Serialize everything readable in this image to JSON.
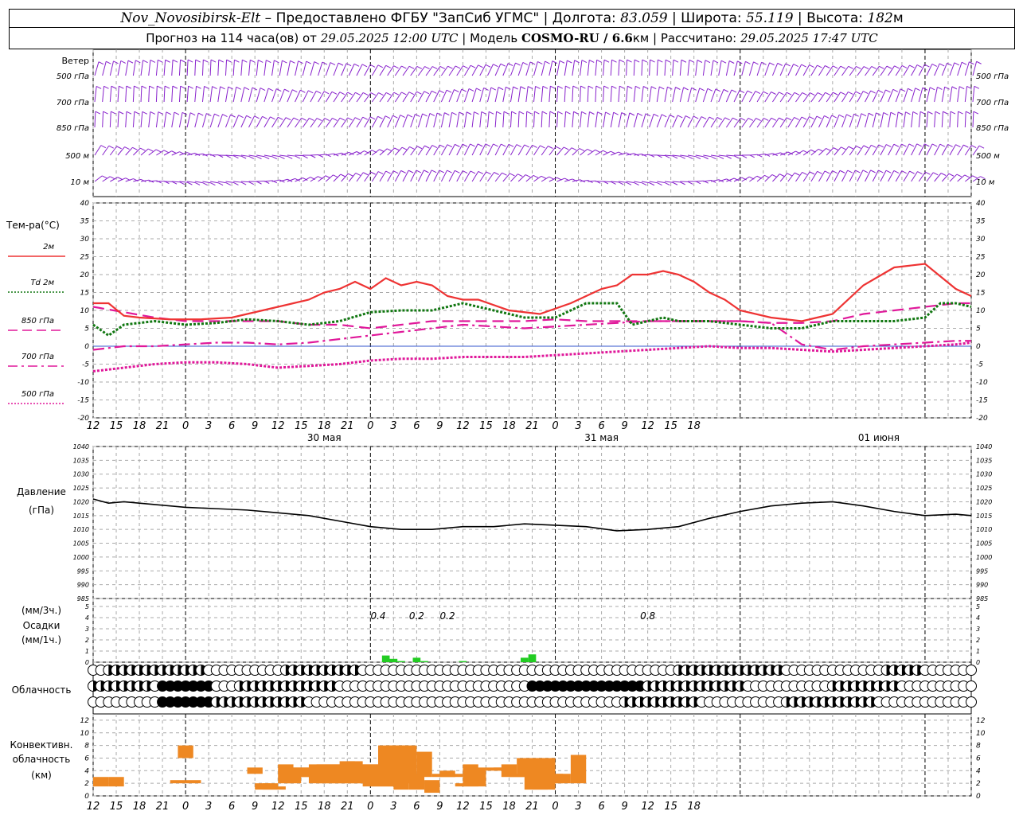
{
  "header": {
    "station": "Nov_Novosibirsk-Elt",
    "dash": " – ",
    "provider": "Предоставлено ФГБУ \"ЗапСиб УГМС\"",
    "lon_label": "Долгота:",
    "lon": "83.059",
    "lat_label": "Широта:",
    "lat": "55.119",
    "alt_label": "Высота:",
    "alt": "182",
    "alt_unit": "м",
    "sep": " | ",
    "forecast_label": "Прогноз на 114 часа(ов)",
    "from_label": "от",
    "forecast_start": "29.05.2025 12:00 UTC",
    "model_label": "Модель",
    "model": "COSMO-RU / 6.6",
    "model_unit": "км",
    "calc_label": "Рассчитано:",
    "calc_time": "29.05.2025 17:47 UTC"
  },
  "colors": {
    "t2m": "#ee3333",
    "td2m": "#117711",
    "t850": "#e0189a",
    "t700": "#e0189a",
    "t500": "#e0189a",
    "wind": "#8822cc",
    "precip": "#22cc22",
    "conv": "#ee8822",
    "pressure": "#000000",
    "grid": "#aaaaaa"
  },
  "wind": {
    "title": "Ветер",
    "levels": [
      "500 гПа",
      "700 гПа",
      "850 гПа",
      "500 м",
      "10  м"
    ]
  },
  "temperature": {
    "title": "Тем-ра(°C)",
    "legend": [
      {
        "label": "2м",
        "style": "solid"
      },
      {
        "label": "Td  2м",
        "style": "dotted"
      },
      {
        "label": "850 гПа",
        "style": "dashed"
      },
      {
        "label": "700 гПа",
        "style": "dashdot"
      },
      {
        "label": "500 гПа",
        "style": "dotted"
      }
    ],
    "y_ticks": [
      "40",
      "35",
      "30",
      "25",
      "20",
      "15",
      "10",
      "5",
      "0",
      "-5",
      "-10",
      "-15",
      "-20"
    ],
    "x_ticks": [
      "12",
      "15",
      "18",
      "21",
      "0",
      "3",
      "6",
      "9",
      "12",
      "15",
      "18",
      "21",
      "0",
      "3",
      "6",
      "9",
      "12",
      "15",
      "18",
      "21",
      "0",
      "3",
      "6",
      "9",
      "12",
      "15",
      "18"
    ],
    "dates": [
      "30 мая",
      "31 мая",
      "01 июня"
    ]
  },
  "pressure": {
    "title": "Давление",
    "unit": "(гПа)",
    "y_ticks": [
      "1040",
      "1035",
      "1030",
      "1025",
      "1020",
      "1015",
      "1010",
      "1005",
      "1000",
      "995",
      "990",
      "985"
    ]
  },
  "precip": {
    "unit3": "(мм/3ч.)",
    "title": "Осадки",
    "unit1": "(мм/1ч.)",
    "y_ticks": [
      "5",
      "4",
      "3",
      "2",
      "1",
      "0"
    ],
    "labels": [
      "0.4",
      "0.2",
      "0.2",
      "0.8"
    ]
  },
  "cloud": {
    "title": "Облачность"
  },
  "convective": {
    "title1": "Конвективн.",
    "title2": "облачность",
    "unit": "(км)",
    "y_ticks": [
      "12",
      "10",
      "8",
      "6",
      "4",
      "2",
      "0"
    ],
    "x_ticks": [
      "12",
      "15",
      "18",
      "21",
      "0",
      "3",
      "6",
      "9",
      "12",
      "15",
      "18",
      "21",
      "0",
      "3",
      "6",
      "9",
      "12",
      "15",
      "18",
      "21",
      "0",
      "3",
      "6",
      "9",
      "12",
      "15",
      "18"
    ]
  },
  "chart_data": [
    {
      "type": "line",
      "title": "Тем-ра(°C)",
      "x_unit": "hours from 29.05.2025 12:00 UTC",
      "ylim": [
        -20,
        40
      ],
      "series": [
        {
          "name": "2м",
          "x": [
            0,
            2,
            4,
            6,
            10,
            14,
            18,
            22,
            26,
            28,
            30,
            32,
            34,
            36,
            38,
            40,
            42,
            44,
            46,
            48,
            50,
            54,
            58,
            62,
            64,
            66,
            68,
            70,
            72,
            74,
            76,
            78,
            80,
            82,
            84,
            88,
            92,
            96,
            100,
            104,
            108,
            112,
            114
          ],
          "values": [
            12,
            12,
            8.5,
            8,
            7.5,
            7.5,
            8,
            10,
            12,
            13,
            15,
            16,
            18,
            16,
            19,
            17,
            18,
            17,
            14,
            13,
            13,
            10,
            9,
            12,
            14,
            16,
            17,
            20,
            20,
            21,
            20,
            18,
            15,
            13,
            10,
            8,
            7,
            9,
            17,
            22,
            23,
            16,
            14
          ]
        },
        {
          "name": "Td  2м",
          "x": [
            0,
            2,
            4,
            8,
            12,
            16,
            20,
            24,
            28,
            32,
            36,
            40,
            44,
            48,
            52,
            56,
            60,
            64,
            68,
            70,
            72,
            74,
            76,
            80,
            84,
            88,
            92,
            96,
            100,
            104,
            108,
            110,
            112,
            114
          ],
          "values": [
            6,
            3,
            6,
            7,
            6,
            6.5,
            7.5,
            7,
            6,
            7,
            9.5,
            10,
            10,
            12,
            10,
            8,
            8,
            12,
            12,
            6,
            7,
            8,
            7,
            7,
            6,
            5,
            5,
            7,
            7,
            7,
            8,
            12,
            12,
            11
          ]
        },
        {
          "name": "850 гПа",
          "x": [
            0,
            4,
            8,
            12,
            16,
            20,
            24,
            28,
            32,
            36,
            40,
            44,
            48,
            52,
            56,
            60,
            64,
            68,
            72,
            76,
            80,
            84,
            88,
            92,
            96,
            100,
            104,
            108,
            112,
            114
          ],
          "values": [
            11,
            9.5,
            8,
            7,
            7,
            7,
            7,
            6,
            6,
            5,
            6,
            7,
            7,
            7,
            7,
            7.5,
            7,
            7,
            7,
            7,
            7,
            7,
            6.5,
            6.5,
            7,
            9,
            10,
            11,
            12,
            12
          ]
        },
        {
          "name": "700 гПа",
          "x": [
            0,
            4,
            8,
            12,
            16,
            20,
            24,
            28,
            32,
            36,
            40,
            44,
            48,
            52,
            56,
            60,
            64,
            68,
            72,
            76,
            80,
            84,
            88,
            92,
            96,
            100,
            104,
            108,
            112,
            114
          ],
          "values": [
            -1,
            0,
            0,
            0.5,
            1,
            1,
            0.5,
            1,
            2,
            3,
            4,
            5,
            6,
            5.5,
            5,
            5.5,
            6,
            6.5,
            7,
            7,
            7,
            7,
            6.5,
            0.5,
            -1,
            0,
            0.5,
            1,
            1.5,
            1.5
          ]
        },
        {
          "name": "500 гПа",
          "x": [
            0,
            4,
            8,
            12,
            16,
            20,
            24,
            28,
            32,
            36,
            40,
            44,
            48,
            52,
            56,
            60,
            64,
            68,
            72,
            76,
            80,
            84,
            88,
            92,
            96,
            100,
            104,
            108,
            112,
            114
          ],
          "values": [
            -7,
            -6,
            -5,
            -4.5,
            -4.5,
            -5,
            -6,
            -5.5,
            -5,
            -4,
            -3.5,
            -3.5,
            -3,
            -3,
            -3,
            -2.5,
            -2,
            -1.5,
            -1,
            -0.5,
            0,
            -0.5,
            -0.5,
            -1,
            -1.5,
            -1,
            -0.5,
            0,
            0.5,
            1
          ]
        }
      ]
    },
    {
      "type": "line",
      "title": "Давление",
      "ylim": [
        985,
        1040
      ],
      "series": [
        {
          "name": "Давление",
          "x": [
            0,
            2,
            4,
            8,
            12,
            16,
            20,
            24,
            28,
            32,
            36,
            40,
            44,
            48,
            52,
            56,
            60,
            64,
            68,
            72,
            76,
            80,
            84,
            88,
            92,
            96,
            100,
            104,
            108,
            112,
            114
          ],
          "values": [
            1021,
            1019.5,
            1020,
            1019,
            1018,
            1017.5,
            1017,
            1016,
            1015,
            1013,
            1011,
            1010,
            1010,
            1011,
            1011,
            1012,
            1011.5,
            1011,
            1009.5,
            1010,
            1011,
            1014,
            1016.5,
            1018.5,
            1019.5,
            1020,
            1018.5,
            1016.5,
            1015,
            1015.5,
            1015
          ]
        }
      ]
    },
    {
      "type": "bar",
      "title": "Осадки",
      "ylim": [
        0,
        5
      ],
      "series": [
        {
          "name": "мм/1ч",
          "x": [
            38,
            39,
            40,
            42,
            43,
            48,
            56,
            57
          ],
          "values": [
            0.6,
            0.3,
            0.1,
            0.4,
            0.1,
            0.1,
            0.4,
            0.7
          ]
        }
      ]
    },
    {
      "type": "bar",
      "title": "Конвективн. облачность",
      "ylim": [
        0,
        13
      ],
      "series": [
        {
          "name": "нижняя граница",
          "x": [
            1,
            3,
            11,
            12,
            13,
            21,
            22,
            23,
            24,
            25,
            26,
            27,
            28,
            29,
            30,
            31,
            32,
            33,
            34,
            35,
            36,
            37,
            38,
            39,
            40,
            41,
            42,
            43,
            44,
            45,
            46,
            47,
            48,
            49,
            50,
            52,
            53,
            54,
            55,
            56,
            57,
            58,
            59,
            60,
            61,
            63
          ],
          "values": [
            1.5,
            1.5,
            2,
            6,
            2,
            3.5,
            1,
            1,
            1,
            2,
            2,
            3,
            3,
            2,
            2,
            2,
            2,
            2,
            2,
            2,
            1.5,
            1.5,
            1.5,
            1.5,
            1,
            2,
            1,
            3,
            0.5,
            3,
            3,
            3,
            1.5,
            1.5,
            1.5,
            4,
            4,
            3,
            3,
            3,
            1,
            1,
            1,
            2,
            2,
            2
          ]
        },
        {
          "name": "верхняя граница",
          "x": [
            1,
            3,
            11,
            12,
            13,
            21,
            22,
            23,
            24,
            25,
            26,
            27,
            28,
            29,
            30,
            31,
            32,
            33,
            34,
            35,
            36,
            37,
            38,
            39,
            40,
            41,
            42,
            43,
            44,
            45,
            46,
            47,
            48,
            49,
            50,
            52,
            53,
            54,
            55,
            56,
            57,
            58,
            59,
            60,
            61,
            63
          ],
          "values": [
            3,
            3,
            2.5,
            8,
            2.5,
            4.5,
            2,
            2,
            1.5,
            5,
            4.5,
            4.5,
            4.5,
            5,
            5,
            5,
            5,
            5.5,
            5.5,
            5,
            5,
            5,
            8,
            8,
            8,
            8,
            3.5,
            7,
            2.5,
            3.5,
            4,
            3.5,
            2,
            5,
            4.5,
            4.5,
            4.5,
            5,
            3.5,
            6,
            6,
            6,
            6,
            3.5,
            3.5,
            6.5
          ]
        }
      ]
    }
  ]
}
